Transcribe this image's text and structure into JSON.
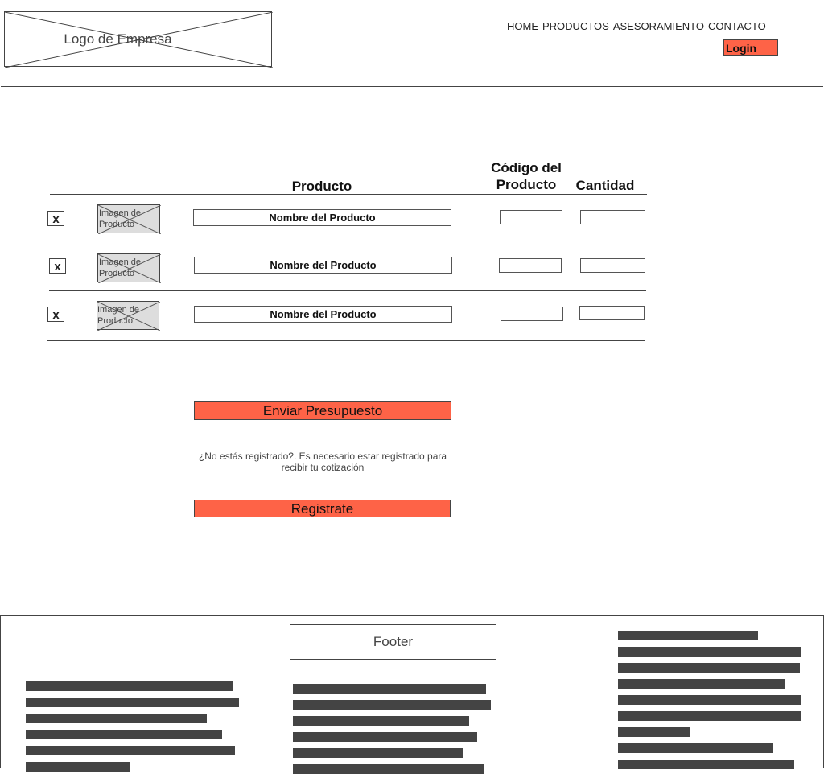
{
  "header": {
    "logo_text": "Logo de Empresa",
    "nav": [
      "HOME",
      "PRODUCTOS",
      "ASESORAMIENTO",
      "CONTACTO"
    ],
    "login_label": "Login"
  },
  "table": {
    "headers": {
      "producto": "Producto",
      "codigo": "Código del Producto",
      "cantidad": "Cantidad"
    },
    "rows": [
      {
        "remove": "x",
        "image": "Imagen de Producto",
        "name": "Nombre del Producto"
      },
      {
        "remove": "x",
        "image": "Imagen de Producto",
        "name": "Nombre del Producto"
      },
      {
        "remove": "x",
        "image": "Imagen de Producto",
        "name": "Nombre del Producto"
      }
    ]
  },
  "actions": {
    "send_label": "Enviar Presupuesto",
    "note": "¿No estás registrado?. Es necesario estar registrado para recibir tu cotización",
    "register_label": "Registrate"
  },
  "footer": {
    "title": "Footer"
  },
  "colors": {
    "accent": "#fe6347",
    "border": "#444444",
    "placeholder": "#dddddd"
  }
}
